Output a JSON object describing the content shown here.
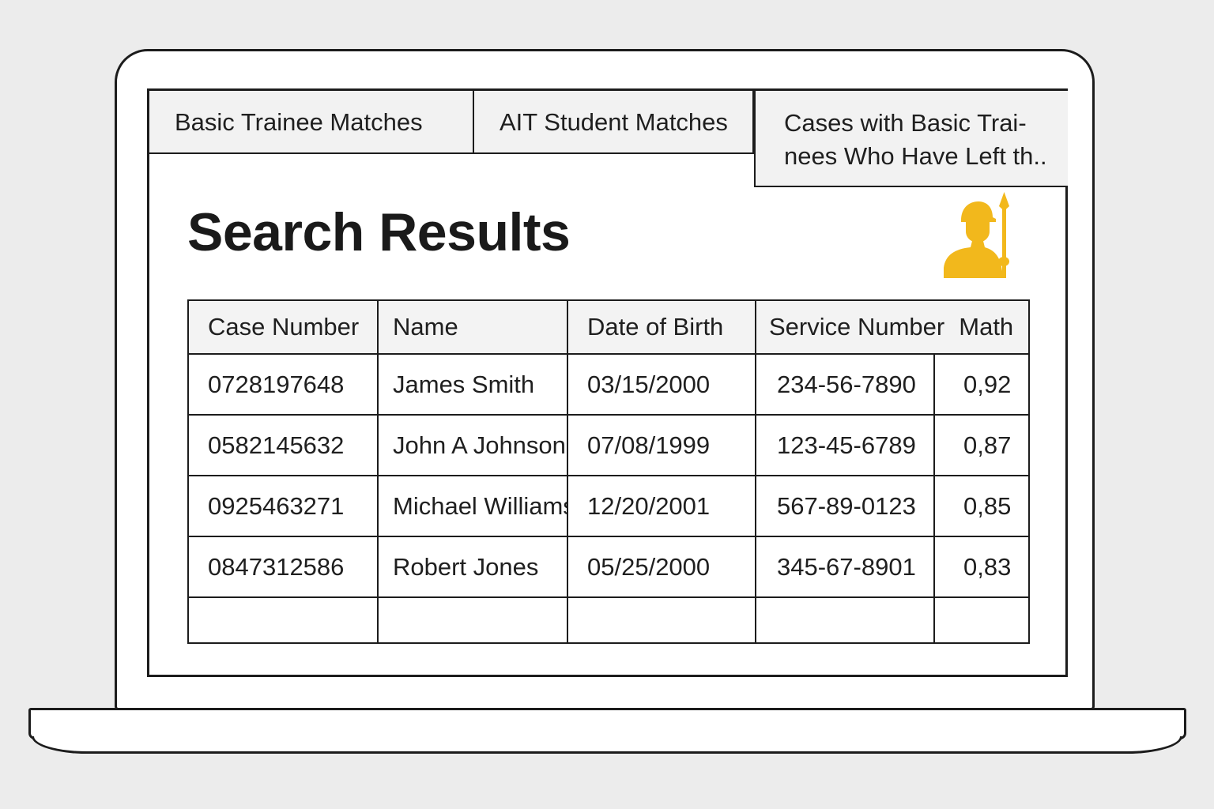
{
  "tabs": [
    {
      "label": "Basic Trainee Matches"
    },
    {
      "label": "AIT Student Matches"
    },
    {
      "label_line1": "Cases with Basic Trai-",
      "label_line2": "nees Who Have Left th.."
    }
  ],
  "page": {
    "title": "Search Results"
  },
  "mascot": {
    "icon": "soldier-with-spear-icon",
    "color": "#f2b81c"
  },
  "table": {
    "columns": [
      "Case Number",
      "Name",
      "Date of Birth",
      "Service Number",
      "Math"
    ],
    "rows": [
      {
        "case_number": "0728197648",
        "name": "James Smith",
        "dob": "03/15/2000",
        "service_number": "234-56-7890",
        "math": "0,92"
      },
      {
        "case_number": "0582145632",
        "name": "John A Johnson",
        "dob": "07/08/1999",
        "service_number": "123-45-6789",
        "math": "0,87"
      },
      {
        "case_number": "0925463271",
        "name": "Michael Williams",
        "dob": "12/20/2001",
        "service_number": "567-89-0123",
        "math": "0,85"
      },
      {
        "case_number": "0847312586",
        "name": "Robert Jones",
        "dob": "05/25/2000",
        "service_number": "345-67-8901",
        "math": "0,83"
      }
    ]
  }
}
